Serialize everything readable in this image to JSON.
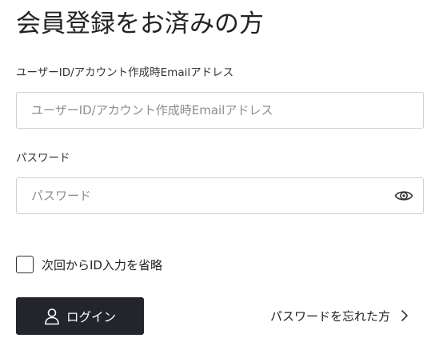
{
  "page": {
    "title": "会員登録をお済みの方"
  },
  "form": {
    "id_label": "ユーザーID/アカウント作成時Emailアドレス",
    "id_placeholder": "ユーザーID/アカウント作成時Emailアドレス",
    "id_value": "",
    "password_label": "パスワード",
    "password_placeholder": "パスワード",
    "password_value": "",
    "password_toggle_icon": "eye-icon",
    "remember_label": "次回からID入力を省略",
    "remember_checked": false
  },
  "actions": {
    "login_label": "ログイン",
    "login_icon": "user-icon",
    "forgot_label": "パスワードを忘れた方",
    "forgot_icon": "chevron-right-icon"
  },
  "colors": {
    "button_bg": "#22252b",
    "border": "#cfcfcf",
    "text": "#222222",
    "placeholder": "#8c8c8c"
  }
}
